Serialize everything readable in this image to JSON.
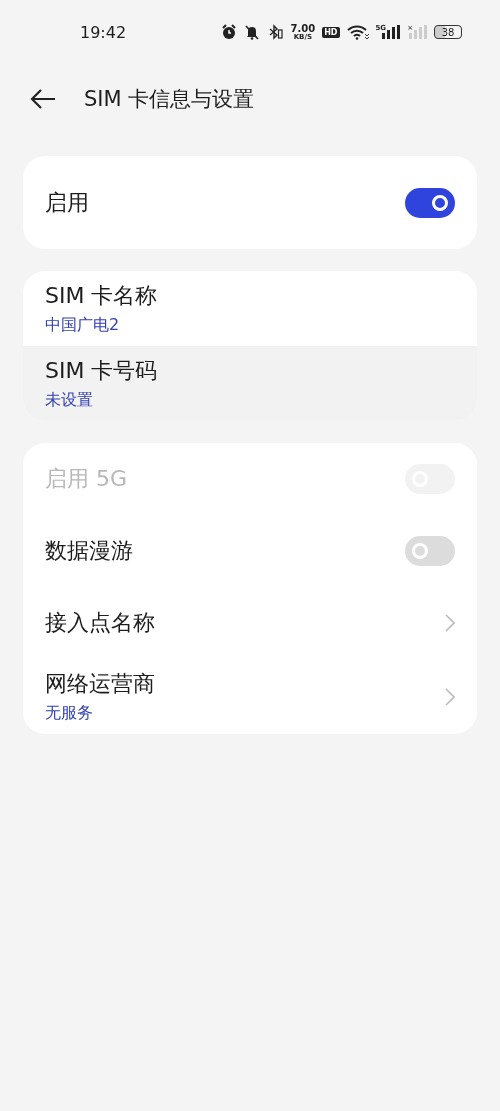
{
  "status_bar": {
    "time": "19:42",
    "speed_value": "7.00",
    "speed_unit": "KB/S",
    "hd_badge": "HD",
    "network_type": "5G",
    "no_signal_mark": "×",
    "battery": "38"
  },
  "header": {
    "title": "SIM 卡信息与设置"
  },
  "cards": [
    {
      "items": [
        {
          "kind": "toggle",
          "label": "启用",
          "on": true,
          "disabled": false
        }
      ]
    },
    {
      "items": [
        {
          "kind": "info",
          "label": "SIM 卡名称",
          "value": "中国广电2",
          "pressed": false
        },
        {
          "kind": "info",
          "label": "SIM 卡号码",
          "value": "未设置",
          "pressed": true
        }
      ]
    },
    {
      "items": [
        {
          "kind": "toggle",
          "label": "启用 5G",
          "on": false,
          "disabled": true
        },
        {
          "kind": "toggle",
          "label": "数据漫游",
          "on": false,
          "disabled": false
        },
        {
          "kind": "nav",
          "label": "接入点名称"
        },
        {
          "kind": "nav",
          "label": "网络运营商",
          "value": "无服务"
        }
      ]
    }
  ]
}
